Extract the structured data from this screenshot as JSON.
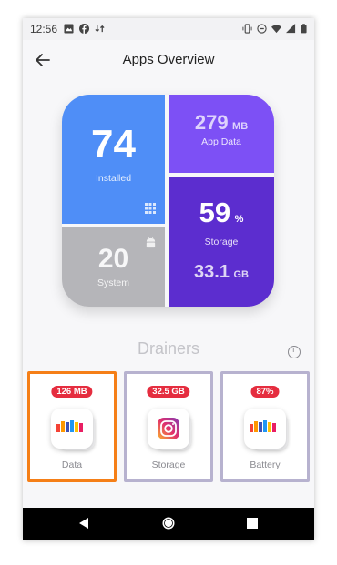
{
  "status_bar": {
    "time": "12:56"
  },
  "app_bar": {
    "title": "Apps Overview"
  },
  "tiles": {
    "installed": {
      "value": "74",
      "label": "Installed"
    },
    "system": {
      "value": "20",
      "label": "System"
    },
    "app_data": {
      "value": "279",
      "unit": "MB",
      "label": "App Data"
    },
    "storage": {
      "percent": "59",
      "percent_unit": "%",
      "label": "Storage",
      "size": "33.1",
      "size_unit": "GB"
    }
  },
  "section": {
    "title": "Drainers"
  },
  "drainers": [
    {
      "badge": "126 MB",
      "label": "Data",
      "selected": true
    },
    {
      "badge": "32.5 GB",
      "label": "Storage",
      "selected": false
    },
    {
      "badge": "87%",
      "label": "Battery",
      "selected": false
    }
  ],
  "colors": {
    "installed": "#4f8ef7",
    "system": "#b5b5b9",
    "app_data": "#7d50f5",
    "storage": "#5c2dcf",
    "badge": "#e52d3f",
    "selected_border": "#f57f17",
    "card_border": "#b7b2cf"
  },
  "icons": {
    "back": "arrow-left-icon",
    "grid": "grid-icon",
    "android": "android-icon",
    "info": "info-icon",
    "nav_back": "triangle-back-icon",
    "nav_home": "circle-home-icon",
    "nav_recents": "square-recents-icon"
  }
}
